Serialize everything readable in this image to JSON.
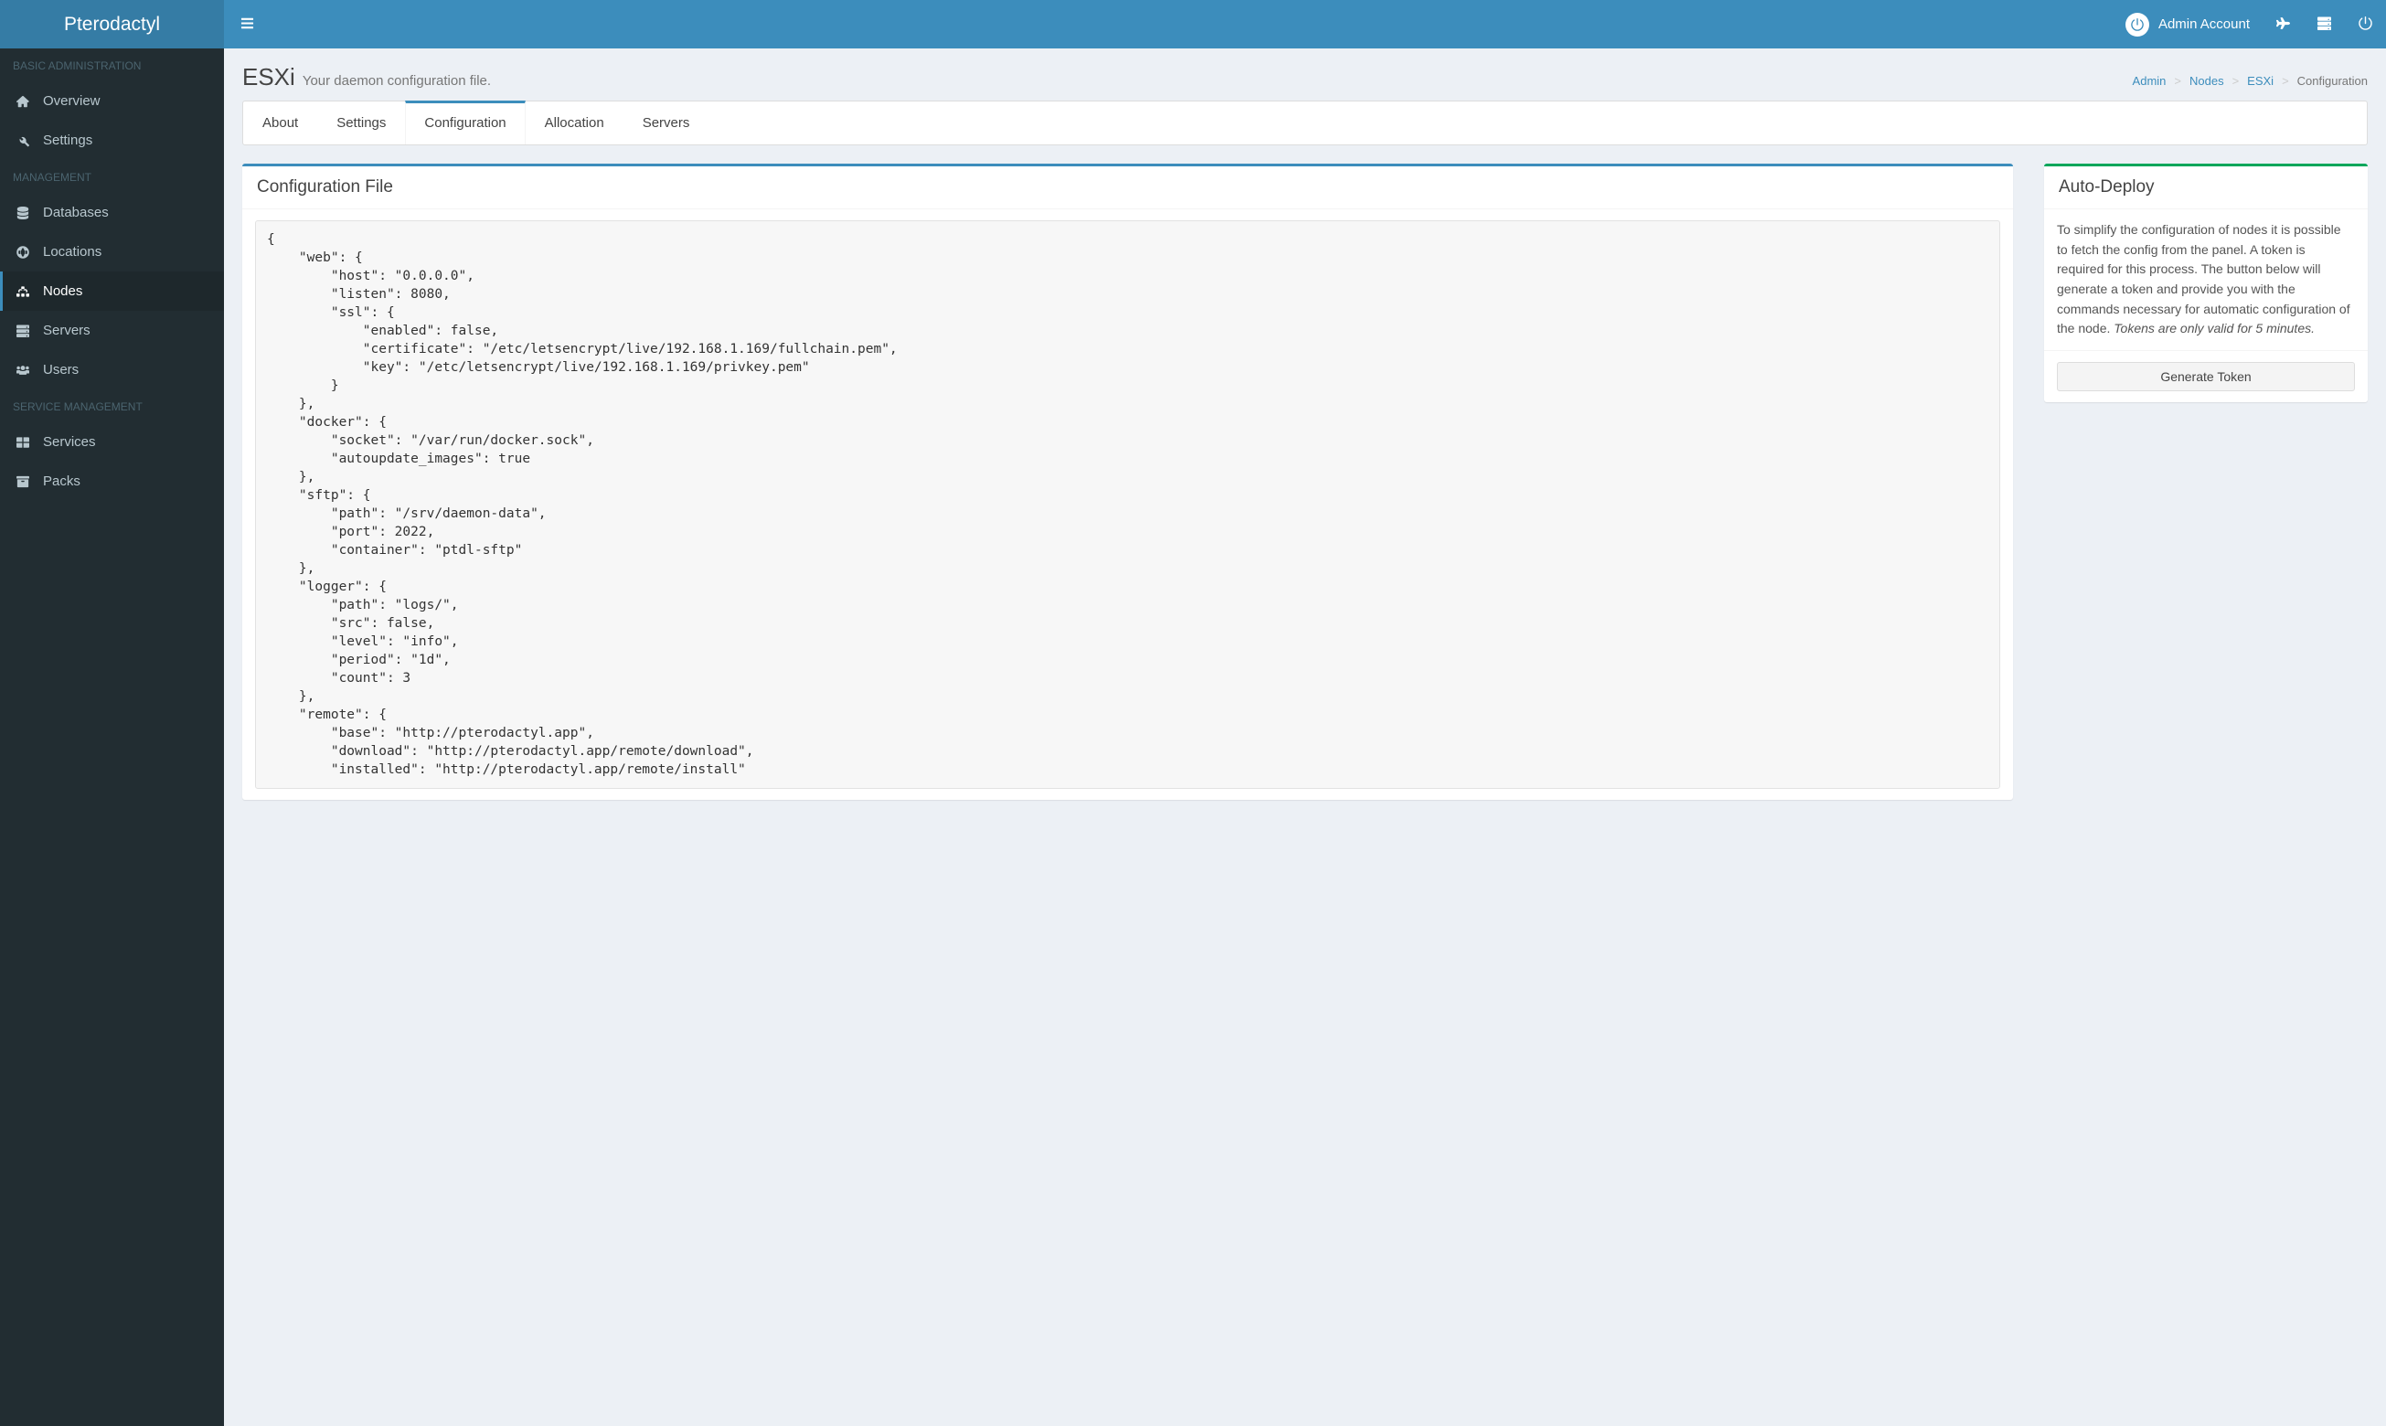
{
  "brand": "Pterodactyl",
  "topbar": {
    "admin_label": "Admin Account"
  },
  "sidebar": {
    "sections": [
      {
        "header": "BASIC ADMINISTRATION",
        "items": [
          {
            "label": "Overview",
            "icon": "home-icon",
            "active": false
          },
          {
            "label": "Settings",
            "icon": "wrench-icon",
            "active": false
          }
        ]
      },
      {
        "header": "MANAGEMENT",
        "items": [
          {
            "label": "Databases",
            "icon": "database-icon",
            "active": false
          },
          {
            "label": "Locations",
            "icon": "globe-icon",
            "active": false
          },
          {
            "label": "Nodes",
            "icon": "sitemap-icon",
            "active": true
          },
          {
            "label": "Servers",
            "icon": "server-icon",
            "active": false
          },
          {
            "label": "Users",
            "icon": "users-icon",
            "active": false
          }
        ]
      },
      {
        "header": "SERVICE MANAGEMENT",
        "items": [
          {
            "label": "Services",
            "icon": "th-large-icon",
            "active": false
          },
          {
            "label": "Packs",
            "icon": "archive-icon",
            "active": false
          }
        ]
      }
    ]
  },
  "header": {
    "title": "ESXi",
    "subtitle": "Your daemon configuration file."
  },
  "breadcrumb": {
    "items": [
      {
        "label": "Admin",
        "kind": "link"
      },
      {
        "label": "Nodes",
        "kind": "link"
      },
      {
        "label": "ESXi",
        "kind": "link"
      },
      {
        "label": "Configuration",
        "kind": "active"
      }
    ]
  },
  "tabs": [
    {
      "label": "About",
      "active": false
    },
    {
      "label": "Settings",
      "active": false
    },
    {
      "label": "Configuration",
      "active": true
    },
    {
      "label": "Allocation",
      "active": false
    },
    {
      "label": "Servers",
      "active": false
    }
  ],
  "config_box": {
    "title": "Configuration File",
    "content": "{\n    \"web\": {\n        \"host\": \"0.0.0.0\",\n        \"listen\": 8080,\n        \"ssl\": {\n            \"enabled\": false,\n            \"certificate\": \"/etc/letsencrypt/live/192.168.1.169/fullchain.pem\",\n            \"key\": \"/etc/letsencrypt/live/192.168.1.169/privkey.pem\"\n        }\n    },\n    \"docker\": {\n        \"socket\": \"/var/run/docker.sock\",\n        \"autoupdate_images\": true\n    },\n    \"sftp\": {\n        \"path\": \"/srv/daemon-data\",\n        \"port\": 2022,\n        \"container\": \"ptdl-sftp\"\n    },\n    \"logger\": {\n        \"path\": \"logs/\",\n        \"src\": false,\n        \"level\": \"info\",\n        \"period\": \"1d\",\n        \"count\": 3\n    },\n    \"remote\": {\n        \"base\": \"http://pterodactyl.app\",\n        \"download\": \"http://pterodactyl.app/remote/download\",\n        \"installed\": \"http://pterodactyl.app/remote/install\""
  },
  "deploy_box": {
    "title": "Auto-Deploy",
    "body_text": "To simplify the configuration of nodes it is possible to fetch the config from the panel. A token is required for this process. The button below will generate a token and provide you with the commands necessary for automatic configuration of the node. ",
    "body_italic": "Tokens are only valid for 5 minutes.",
    "button_label": "Generate Token"
  }
}
